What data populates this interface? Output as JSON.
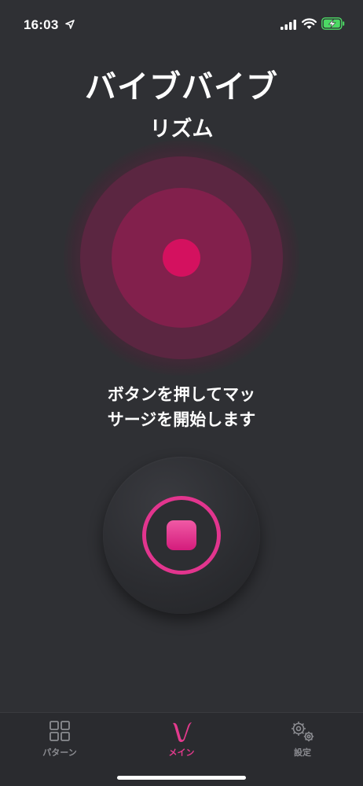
{
  "status_bar": {
    "time": "16:03",
    "icons": [
      "location-arrow-icon",
      "signal-icon",
      "wifi-icon",
      "battery-charging-icon"
    ]
  },
  "header": {
    "title": "バイブバイブ",
    "subtitle": "リズム"
  },
  "instruction": {
    "line1": "ボタンを押してマッ",
    "line2": "サージを開始します"
  },
  "control": {
    "icon": "stop-icon"
  },
  "tabs": [
    {
      "label": "パターン",
      "icon": "grid-icon",
      "active": false
    },
    {
      "label": "メイン",
      "icon": "v-logo-icon",
      "active": true
    },
    {
      "label": "設定",
      "icon": "gears-icon",
      "active": false
    }
  ],
  "colors": {
    "background": "#2f3034",
    "accent": "#e2358e",
    "pulse_core": "#d4115f",
    "tab_inactive": "#8b8c91"
  }
}
